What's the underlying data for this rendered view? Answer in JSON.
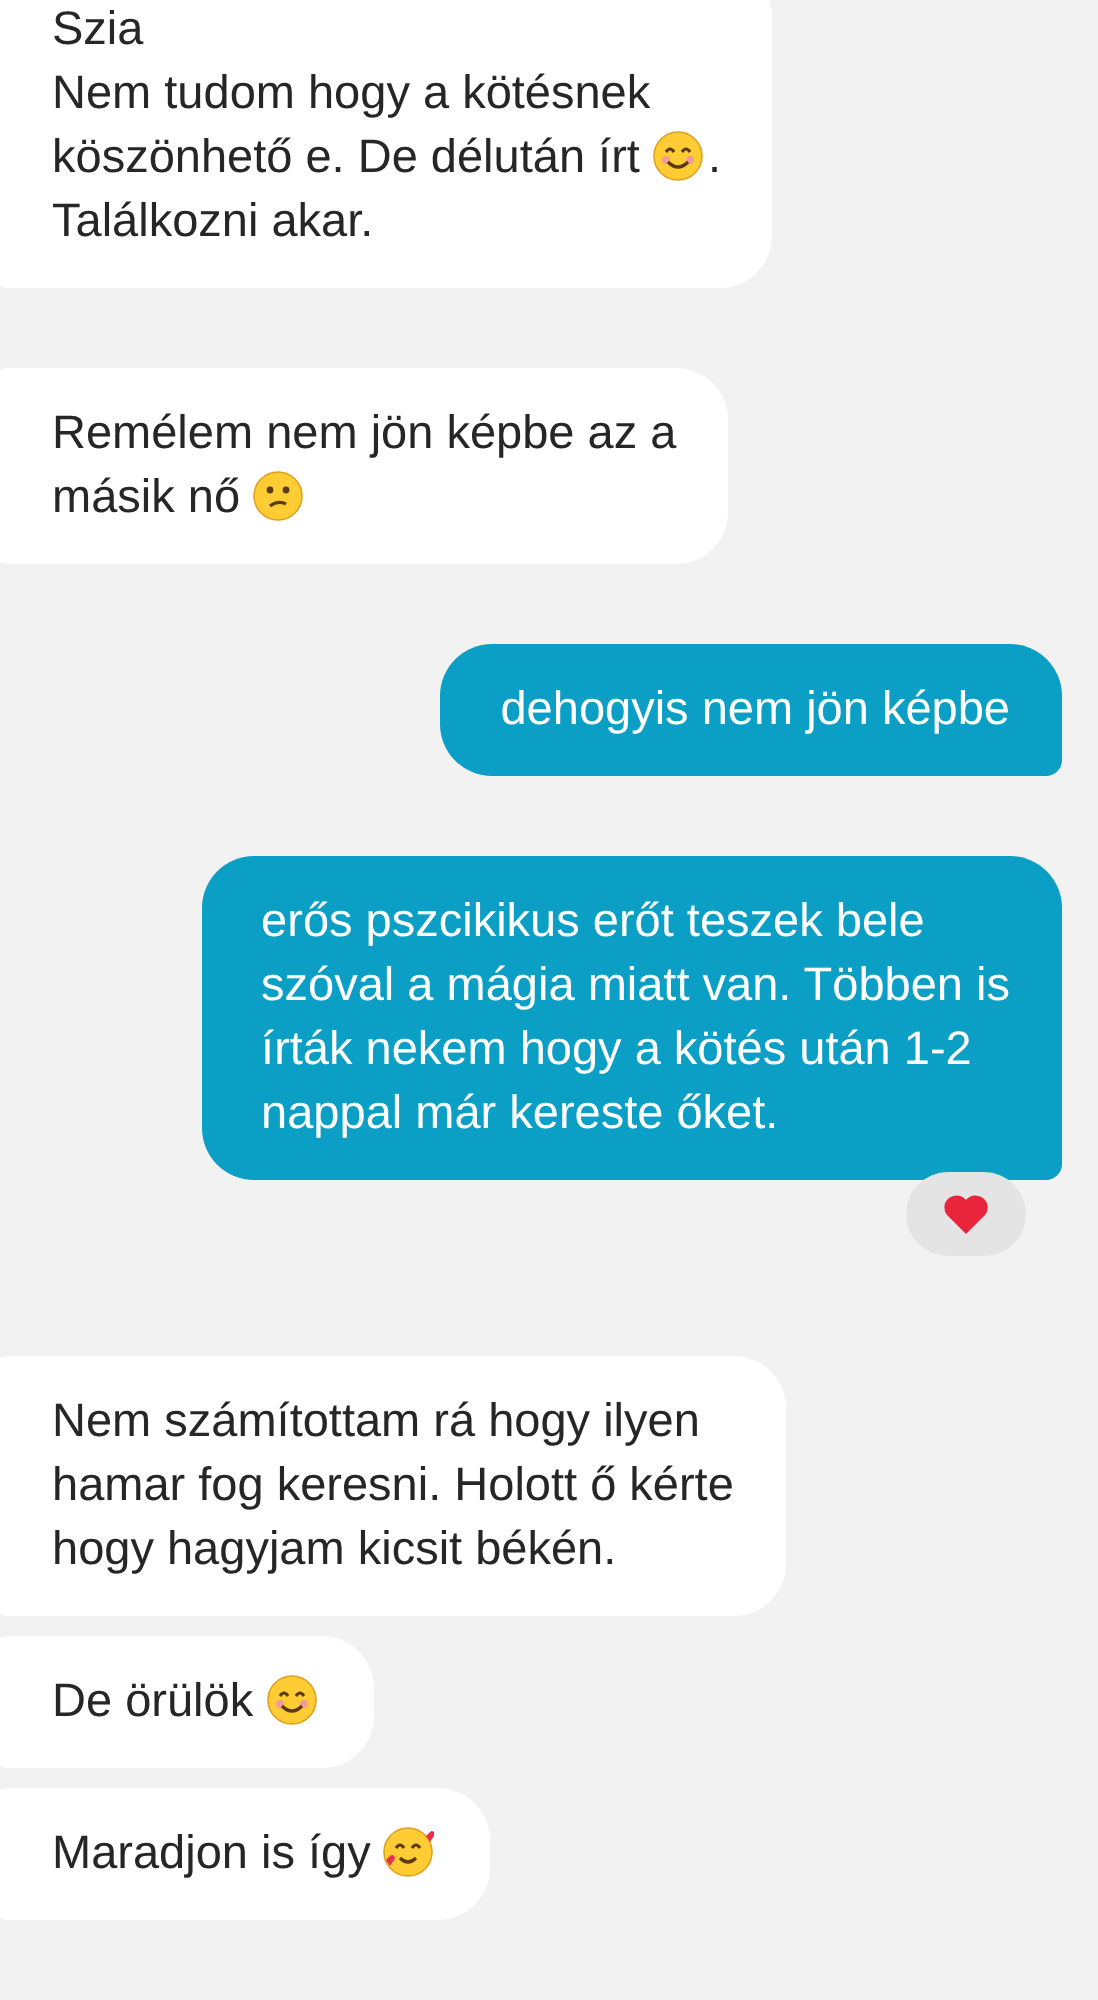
{
  "messages": [
    {
      "kind": "incoming",
      "lines": [
        [
          {
            "kind": "text",
            "text": "Szia"
          }
        ],
        [
          {
            "kind": "text",
            "text": "Nem tudom hogy a kötésnek"
          }
        ],
        [
          {
            "kind": "text",
            "text": "köszönhető e. De délután írt"
          },
          {
            "kind": "smile"
          },
          {
            "kind": "text",
            "text": "."
          }
        ],
        [
          {
            "kind": "text",
            "text": "Találkozni akar."
          }
        ]
      ]
    },
    {
      "kind": "incoming",
      "lines": [
        [
          {
            "kind": "text",
            "text": "Remélem nem jön képbe az a"
          }
        ],
        [
          {
            "kind": "text",
            "text": "másik nő"
          },
          {
            "kind": "confused"
          }
        ]
      ]
    },
    {
      "kind": "outgoing",
      "lines": [
        [
          {
            "kind": "text",
            "text": "dehogyis nem jön képbe"
          }
        ]
      ]
    },
    {
      "kind": "outgoing",
      "lines": [
        [
          {
            "kind": "text",
            "text": "erős pszcikikus erőt teszek bele"
          }
        ],
        [
          {
            "kind": "text",
            "text": "szóval a mágia miatt van. Többen is"
          }
        ],
        [
          {
            "kind": "text",
            "text": "írták nekem hogy a kötés után 1-2"
          }
        ],
        [
          {
            "kind": "text",
            "text": "nappal már kereste őket."
          }
        ]
      ],
      "reaction": {
        "kind": "heart"
      }
    },
    {
      "kind": "incoming",
      "lines": [
        [
          {
            "kind": "text",
            "text": "Nem számítottam rá hogy ilyen"
          }
        ],
        [
          {
            "kind": "text",
            "text": "hamar fog keresni. Holott ő kérte"
          }
        ],
        [
          {
            "kind": "text",
            "text": "hogy hagyjam kicsit békén."
          }
        ]
      ]
    },
    {
      "kind": "incoming",
      "lines": [
        [
          {
            "kind": "text",
            "text": "De örülök"
          },
          {
            "kind": "smile"
          }
        ]
      ]
    },
    {
      "kind": "incoming",
      "lines": [
        [
          {
            "kind": "text",
            "text": "Maradjon is így"
          },
          {
            "kind": "hearts"
          }
        ]
      ]
    }
  ]
}
